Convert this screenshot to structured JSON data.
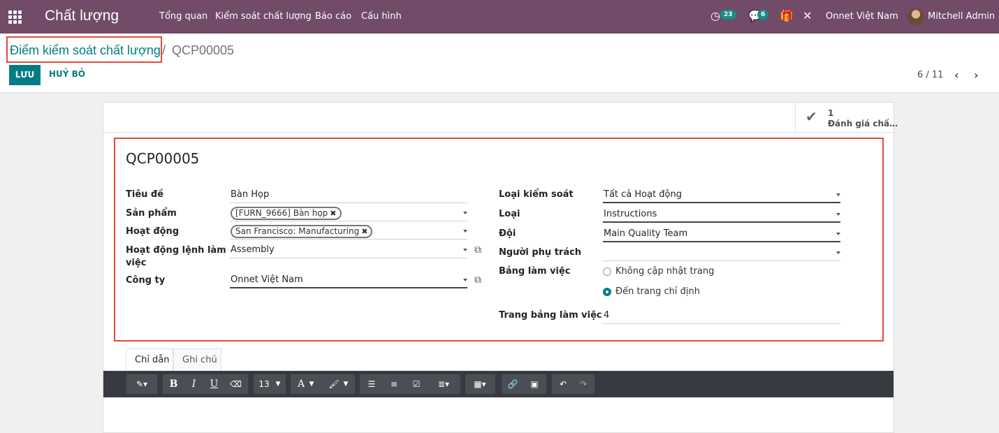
{
  "topbar": {
    "app_title": "Chất lượng",
    "menu": [
      "Tổng quan",
      "Kiểm soát chất lượng",
      "Báo cáo",
      "Cấu hình"
    ],
    "activity_count": "23",
    "message_count": "6",
    "company": "Onnet Việt Nam",
    "user": "Mitchell Admin",
    "accent_color": "#714b67"
  },
  "breadcrumb": {
    "parent": "Điểm kiểm soát chất lượng",
    "separator": "/",
    "current": "QCP00005"
  },
  "buttons": {
    "save": "LƯU",
    "discard": "HUỶ BỎ"
  },
  "pager": {
    "value": "6 / 11",
    "prev_icon": "chevron-left-icon",
    "next_icon": "chevron-right-icon"
  },
  "smart_button": {
    "count": "1",
    "label": "Đánh giá chấ…",
    "icon": "check-icon"
  },
  "form": {
    "title": "QCP00005",
    "left": {
      "title_label": "Tiêu đề",
      "title_value": "Bàn Họp",
      "product_label": "Sản phẩm",
      "product_tag": "[FURN_9666] Bàn họp",
      "operation_label": "Hoạt động",
      "operation_tag": "San Francisco: Manufacturing",
      "workorder_label_1": "Hoạt động lệnh làm",
      "workorder_label_2": "việc",
      "workorder_value": "Assembly",
      "company_label": "Công ty",
      "company_value": "Onnet Việt Nam"
    },
    "right": {
      "control_type_label": "Loại kiểm soát",
      "control_type_value": "Tất cả Hoạt động",
      "type_label": "Loại",
      "type_value": "Instructions",
      "team_label": "Đội",
      "team_value": "Main Quality Team",
      "responsible_label": "Người phụ trách",
      "responsible_value": "",
      "worksheet_label": "Bảng làm việc",
      "worksheet_option_1": "Không cập nhật trang",
      "worksheet_option_2": "Đến trang chỉ định",
      "worksheet_selected": "Đến trang chỉ định",
      "worksheet_page_label": "Trang bảng làm việc",
      "worksheet_page_value": "4"
    }
  },
  "tabs": [
    "Chỉ dẫn",
    "Ghi chú"
  ],
  "editor_toolbar": {
    "font_size": "13",
    "bold": "B",
    "italic": "I",
    "underline": "U",
    "font_color": "A"
  }
}
